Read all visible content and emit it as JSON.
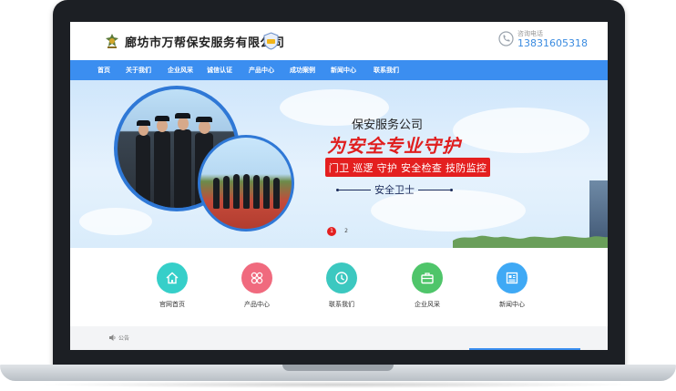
{
  "header": {
    "company_name": "廊坊市万帮保安服务有限公司",
    "phone_label": "咨询电话",
    "phone_number": "13831605318"
  },
  "nav": {
    "items": [
      "首页",
      "关于我们",
      "企业风采",
      "诚信认证",
      "产品中心",
      "成功案例",
      "新闻中心",
      "联系我们"
    ]
  },
  "banner": {
    "title": "保安服务公司",
    "slogan": "为安全专业守护",
    "services": "门卫 巡逻 守护 安全检查 技防监控",
    "tag": "安全卫士",
    "pages": [
      "1",
      "2"
    ],
    "active_page": "1"
  },
  "quick_links": [
    {
      "label": "官网首页",
      "icon": "home-icon",
      "color": "#36cfc9"
    },
    {
      "label": "产品中心",
      "icon": "grid-icon",
      "color": "#f06a7e"
    },
    {
      "label": "联系我们",
      "icon": "clock-icon",
      "color": "#3cc8c0"
    },
    {
      "label": "企业风采",
      "icon": "briefcase-icon",
      "color": "#4fc56a"
    },
    {
      "label": "新闻中心",
      "icon": "news-icon",
      "color": "#3fa9f5"
    }
  ],
  "notice": {
    "label": "公告"
  },
  "colors": {
    "nav_bg": "#3b8ef0",
    "slogan": "#e01e1e",
    "services_bg": "#e41f1f",
    "phone": "#3a8be0"
  }
}
